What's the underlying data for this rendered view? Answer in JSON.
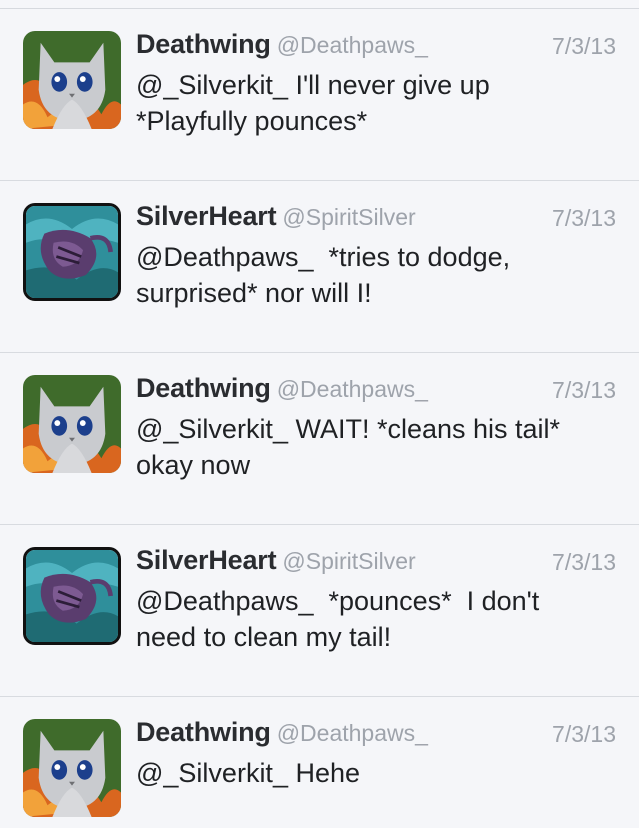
{
  "tweets": [
    {
      "name": "Deathwing",
      "handle": "@Deathpaws_",
      "date": "7/3/13",
      "text": "@_Silverkit_ I'll never give up\n*Playfully pounces*",
      "avatar_icon": "gray-kitten-avatar-icon"
    },
    {
      "name": "SilverHeart",
      "handle": "@SpiritSilver",
      "date": "7/3/13",
      "text": "@Deathpaws_  *tries to dodge,\nsurprised* nor will I!",
      "avatar_icon": "purple-cat-avatar-icon"
    },
    {
      "name": "Deathwing",
      "handle": "@Deathpaws_",
      "date": "7/3/13",
      "text": "@_Silverkit_ WAIT! *cleans his tail*\nokay now",
      "avatar_icon": "gray-kitten-avatar-icon"
    },
    {
      "name": "SilverHeart",
      "handle": "@SpiritSilver",
      "date": "7/3/13",
      "text": "@Deathpaws_  *pounces*  I don't\nneed to clean my tail!",
      "avatar_icon": "purple-cat-avatar-icon"
    },
    {
      "name": "Deathwing",
      "handle": "@Deathpaws_",
      "date": "7/3/13",
      "text": "@_Silverkit_ Hehe",
      "avatar_icon": "gray-kitten-avatar-icon"
    }
  ],
  "colors": {
    "background": "#f5f6f9",
    "name": "#2a2c30",
    "meta": "#9ea3ab",
    "text": "#1f2124",
    "divider": "#d8dbe0"
  }
}
